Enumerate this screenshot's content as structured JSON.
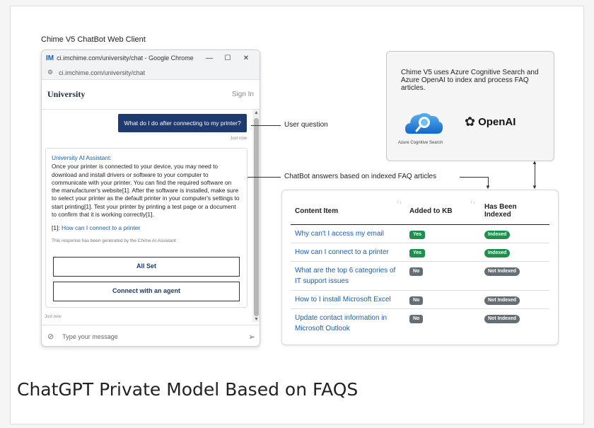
{
  "caption": "Chime V5 ChatBot Web Client",
  "browser": {
    "title": "ci.imchime.com/university/chat - Google Chrome",
    "favicon": "IM",
    "url": "ci.imchime.com/university/chat",
    "min": "—",
    "max": "☐",
    "close": "✕"
  },
  "site": {
    "logo": "University",
    "sign_in": "Sign In"
  },
  "chat": {
    "user_question": "What do I do after connecting to my printer?",
    "user_time": "Just now",
    "assistant_name": "University AI Assistant:",
    "assistant_text": "Once your printer is connected to your device, you may need to download and install drivers or software to your computer to communicate with your printer. You can find the required software on the manufacturer's website[1]. After the software is installed, make sure to select your printer as the default printer in your computer's settings to start printing[1]. Test your printer by printing a test page or a document to confirm that it is working correctly[1].",
    "ref_label": "[1]:",
    "ref_link": "How can I connect to a printer",
    "note": "This response has been generated by the Chime AI Assistant",
    "btn_all_set": "All Set",
    "btn_agent": "Connect with an agent",
    "assistant_time": "Just now",
    "placeholder": "Type your message"
  },
  "annotations": {
    "user_question": "User question",
    "chatbot_answers": "ChatBot answers based on indexed FAQ articles"
  },
  "info_box": {
    "text": "Chime V5 uses Azure Cognitive Search and Azure OpenAI to index and process FAQ articles.",
    "azure_label": "Azure Cognitive Search",
    "openai_label": "OpenAI"
  },
  "table": {
    "headers": [
      "Content Item",
      "Added to KB",
      "Has Been Indexed"
    ],
    "rows": [
      {
        "item": "Why can't I access my email",
        "kb": "Yes",
        "indexed": "Indexed"
      },
      {
        "item": "How can I connect to a printer",
        "kb": "Yes",
        "indexed": "Indexed"
      },
      {
        "item": "What are the top 6 categories of IT support issues",
        "kb": "No",
        "indexed": "Not Indexed"
      },
      {
        "item": "How to I install Microsoft Excel",
        "kb": "No",
        "indexed": "Not Indexed"
      },
      {
        "item": "Update contact information in Microsoft Outlook",
        "kb": "No",
        "indexed": "Not Indexed"
      }
    ]
  },
  "title": "ChatGPT Private Model Based on FAQS",
  "colors": {
    "accent_navy": "#1f3a6e",
    "link_blue": "#1b5fb4",
    "badge_green": "#1f8f4e",
    "badge_gray": "#666e75"
  }
}
